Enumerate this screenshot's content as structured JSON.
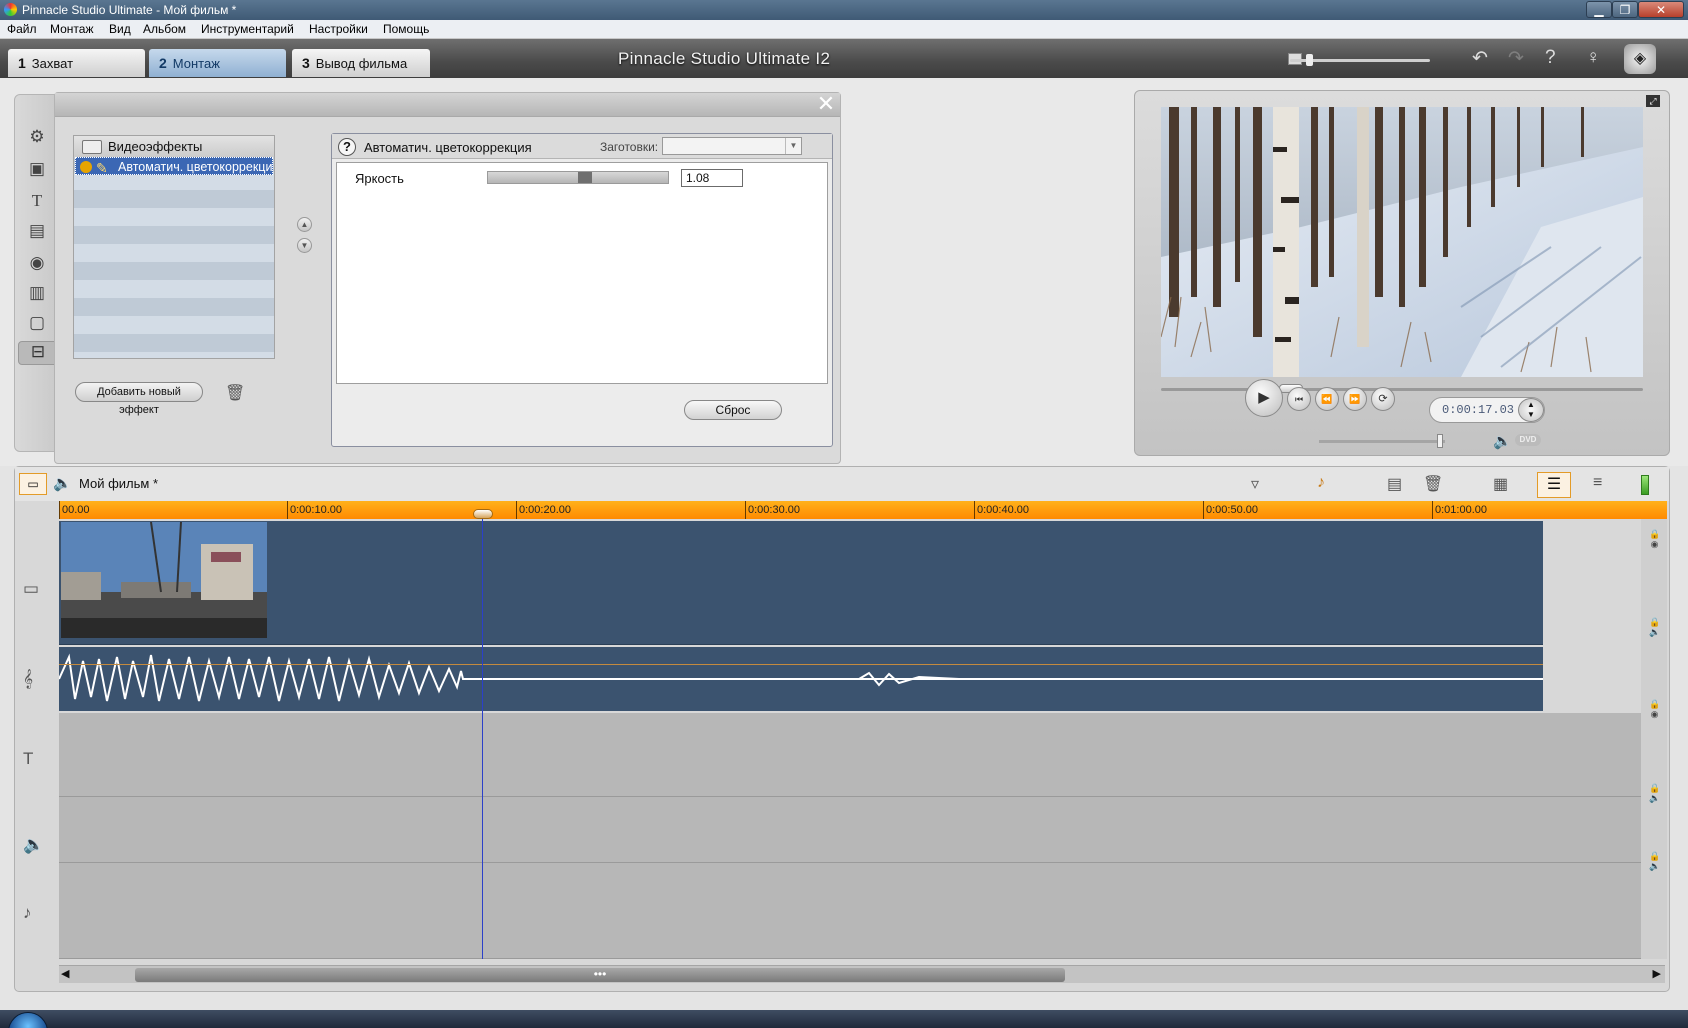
{
  "window": {
    "title": "Pinnacle Studio Ultimate - Мой фильм *"
  },
  "menu": [
    "Файл",
    "Монтаж",
    "Вид",
    "Альбом",
    "Инструментарий",
    "Настройки",
    "Помощь"
  ],
  "tabs": [
    {
      "num": "1",
      "label": "Захват"
    },
    {
      "num": "2",
      "label": "Монтаж"
    },
    {
      "num": "3",
      "label": "Вывод фильма"
    }
  ],
  "app_title": "Pinnacle Studio Ultimate I2",
  "effects": {
    "tree_header": "Видеоэффекты",
    "selected_item": "Автоматич. цветокоррекция",
    "add_button": "Добавить новый эффект"
  },
  "params": {
    "title": "Автоматич. цветокоррекция",
    "presets_label": "Заготовки:",
    "presets_value": "",
    "brightness_label": "Яркость",
    "brightness_value": "1.08",
    "brightness_slider_fraction": 0.54,
    "reset_button": "Сброс"
  },
  "preview": {
    "timecode": "0:00:17.03",
    "dvd_label": "DVD",
    "scrub_fraction": 0.27,
    "volume_fraction": 0.97
  },
  "timeline": {
    "title": "Мой фильм *",
    "ticks": [
      "00.00",
      "0:00:10.00",
      "0:00:20.00",
      "0:00:30.00",
      "0:00:40.00",
      "0:00:50.00",
      "0:01:00.00"
    ],
    "playhead_time": "0:00:17.03"
  }
}
